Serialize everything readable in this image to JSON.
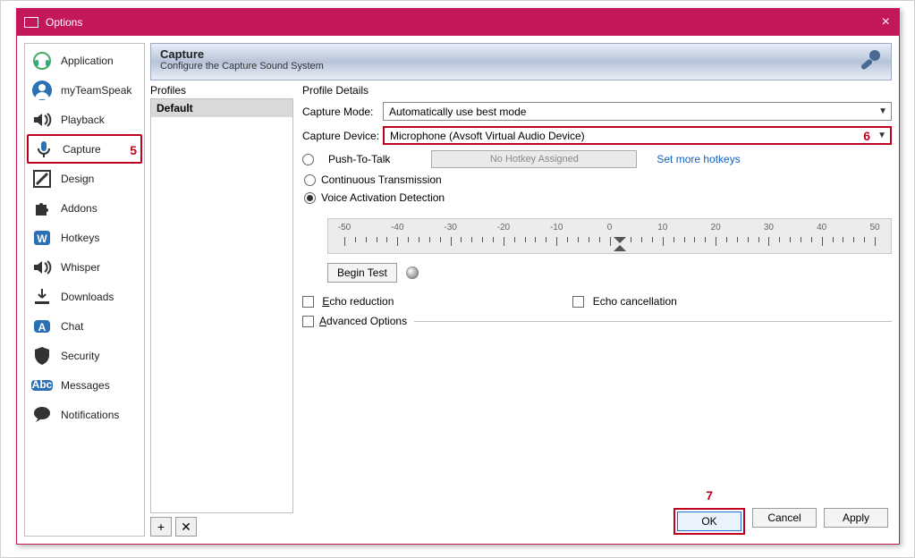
{
  "window": {
    "title": "Options"
  },
  "sidebar": {
    "items": [
      {
        "label": "Application",
        "icon": "headset"
      },
      {
        "label": "myTeamSpeak",
        "icon": "person"
      },
      {
        "label": "Playback",
        "icon": "speaker"
      },
      {
        "label": "Capture",
        "icon": "microphone",
        "selected": true
      },
      {
        "label": "Design",
        "icon": "ruler"
      },
      {
        "label": "Addons",
        "icon": "puzzle"
      },
      {
        "label": "Hotkeys",
        "icon": "keyboard"
      },
      {
        "label": "Whisper",
        "icon": "speaker"
      },
      {
        "label": "Downloads",
        "icon": "download"
      },
      {
        "label": "Chat",
        "icon": "badge-a"
      },
      {
        "label": "Security",
        "icon": "shield"
      },
      {
        "label": "Messages",
        "icon": "badge-abc"
      },
      {
        "label": "Notifications",
        "icon": "speech"
      }
    ]
  },
  "header": {
    "title": "Capture",
    "subtitle": "Configure the Capture Sound System"
  },
  "profiles": {
    "label": "Profiles",
    "items": [
      "Default"
    ],
    "add": "+",
    "remove": "✕"
  },
  "details": {
    "label": "Profile Details",
    "capture_mode_label": "Capture Mode:",
    "capture_mode_value": "Automatically use best mode",
    "capture_device_label": "Capture Device:",
    "capture_device_value": "Microphone (Avsoft Virtual Audio Device)",
    "ptt_label": "Push-To-Talk",
    "no_hotkey": "No Hotkey Assigned",
    "more_hotkeys": "Set more hotkeys",
    "continuous_label": "Continuous Transmission",
    "vad_label": "Voice Activation Detection",
    "slider_ticks": [
      "-50",
      "-40",
      "-30",
      "-20",
      "-10",
      "0",
      "10",
      "20",
      "30",
      "40",
      "50"
    ],
    "slider_value": 2,
    "begin_test": "Begin Test",
    "echo_reduction": "Echo reduction",
    "echo_cancellation": "Echo cancellation",
    "advanced": "Advanced Options"
  },
  "footer": {
    "ok": "OK",
    "cancel": "Cancel",
    "apply": "Apply"
  },
  "annotations": {
    "sidebar": "5",
    "device": "6",
    "ok": "7"
  }
}
